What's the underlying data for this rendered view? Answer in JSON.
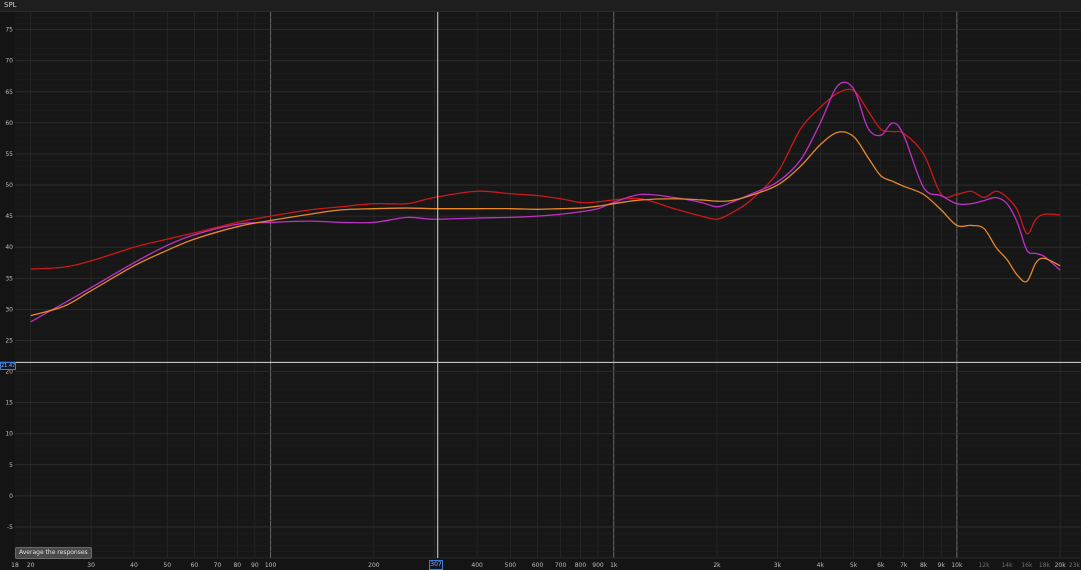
{
  "window": {
    "title": "SPL"
  },
  "cursor": {
    "x_label": "307",
    "y_label": "21.47"
  },
  "buttons": {
    "average": "Average the responses"
  },
  "chart_data": {
    "type": "line",
    "title": "",
    "xlabel": "",
    "ylabel": "SPL",
    "x_scale": "log",
    "xlim": [
      18,
      23000
    ],
    "ylim": [
      -10,
      78
    ],
    "grid": true,
    "x_ticks": [
      {
        "v": 18,
        "label": "18"
      },
      {
        "v": 20,
        "label": "20"
      },
      {
        "v": 30,
        "label": "30"
      },
      {
        "v": 40,
        "label": "40"
      },
      {
        "v": 50,
        "label": "50"
      },
      {
        "v": 60,
        "label": "60"
      },
      {
        "v": 70,
        "label": "70"
      },
      {
        "v": 80,
        "label": "80"
      },
      {
        "v": 90,
        "label": "90"
      },
      {
        "v": 100,
        "label": "100"
      },
      {
        "v": 200,
        "label": "200"
      },
      {
        "v": 400,
        "label": "400"
      },
      {
        "v": 500,
        "label": "500"
      },
      {
        "v": 600,
        "label": "600"
      },
      {
        "v": 700,
        "label": "700"
      },
      {
        "v": 800,
        "label": "800"
      },
      {
        "v": 900,
        "label": "900"
      },
      {
        "v": 1000,
        "label": "1k"
      },
      {
        "v": 2000,
        "label": "2k"
      },
      {
        "v": 3000,
        "label": "3k"
      },
      {
        "v": 4000,
        "label": "4k"
      },
      {
        "v": 5000,
        "label": "5k"
      },
      {
        "v": 6000,
        "label": "6k"
      },
      {
        "v": 7000,
        "label": "7k"
      },
      {
        "v": 8000,
        "label": "8k"
      },
      {
        "v": 9000,
        "label": "9k"
      },
      {
        "v": 10000,
        "label": "10k"
      },
      {
        "v": 12000,
        "label": "12k",
        "dim": true
      },
      {
        "v": 14000,
        "label": "14k",
        "dim": true
      },
      {
        "v": 16000,
        "label": "16k",
        "dim": true
      },
      {
        "v": 18000,
        "label": "18k",
        "dim": true
      },
      {
        "v": 20000,
        "label": "20k"
      },
      {
        "v": 23000,
        "label": "23k",
        "dim": true
      }
    ],
    "y_ticks": [
      75,
      70,
      65,
      60,
      55,
      50,
      45,
      40,
      35,
      30,
      25,
      20,
      15,
      10,
      5,
      0,
      -5
    ],
    "series": [
      {
        "color": "#cc1818",
        "x": [
          20,
          25,
          30,
          40,
          50,
          60,
          80,
          100,
          130,
          160,
          200,
          250,
          300,
          400,
          500,
          600,
          700,
          800,
          900,
          1000,
          1200,
          1500,
          1800,
          2000,
          2200,
          2500,
          3000,
          3500,
          4000,
          4500,
          5000,
          5500,
          6000,
          6500,
          7000,
          8000,
          9000,
          10000,
          11000,
          12000,
          13000,
          14000,
          15000,
          16000,
          17000,
          18000,
          20000
        ],
        "y": [
          36.5,
          36.8,
          37.8,
          40,
          41.3,
          42.3,
          44,
          45,
          46,
          46.5,
          47,
          47,
          48,
          49,
          48.6,
          48.3,
          47.8,
          47.2,
          47.3,
          47.6,
          47.8,
          46.2,
          45,
          44.5,
          45.5,
          47.5,
          52,
          59,
          62.5,
          64.8,
          65.2,
          62,
          59,
          58.6,
          58.3,
          55,
          48.5,
          48.5,
          49,
          48,
          49,
          48,
          46,
          42.2,
          44.5,
          45.3,
          45.2
        ]
      },
      {
        "color": "#c030c8",
        "x": [
          20,
          25,
          30,
          40,
          50,
          60,
          80,
          100,
          130,
          160,
          200,
          250,
          300,
          400,
          500,
          600,
          700,
          800,
          900,
          1000,
          1200,
          1500,
          1800,
          2000,
          2200,
          2500,
          3000,
          3500,
          4000,
          4500,
          5000,
          5500,
          6000,
          6500,
          7000,
          8000,
          9000,
          10000,
          11000,
          12000,
          13000,
          14000,
          15000,
          16000,
          17000,
          18000,
          20000
        ],
        "y": [
          28,
          31,
          33.5,
          37.5,
          40.3,
          42,
          43.7,
          44,
          44.2,
          44,
          44,
          44.8,
          44.5,
          44.7,
          44.8,
          45,
          45.3,
          45.7,
          46.2,
          47.2,
          48.5,
          48,
          47.2,
          46.5,
          47.2,
          48.5,
          50.5,
          54,
          60,
          66,
          65.5,
          59.2,
          58,
          60,
          58,
          49.6,
          48.3,
          47,
          47,
          47.5,
          48,
          47,
          44,
          39.5,
          39,
          38.5,
          36.3
        ]
      },
      {
        "color": "#e8892a",
        "x": [
          20,
          25,
          30,
          40,
          50,
          60,
          80,
          100,
          130,
          160,
          200,
          250,
          300,
          400,
          500,
          600,
          700,
          800,
          900,
          1000,
          1200,
          1500,
          1800,
          2000,
          2200,
          2500,
          3000,
          3500,
          4000,
          4500,
          5000,
          5500,
          6000,
          6500,
          7000,
          8000,
          9000,
          10000,
          11000,
          12000,
          13000,
          14000,
          15000,
          16000,
          17000,
          18000,
          20000
        ],
        "y": [
          29,
          30.5,
          33,
          37,
          39.5,
          41.3,
          43.3,
          44.3,
          45.3,
          46,
          46.2,
          46.3,
          46.2,
          46.2,
          46.2,
          46.1,
          46.2,
          46.3,
          46.6,
          47,
          47.6,
          47.8,
          47.6,
          47.4,
          47.5,
          48.3,
          50,
          53,
          56.5,
          58.5,
          57.8,
          54.5,
          51.5,
          50.6,
          49.8,
          48.5,
          46,
          43.5,
          43.5,
          43,
          40,
          38,
          35.5,
          34.5,
          37.5,
          38.2,
          37
        ]
      }
    ],
    "cursor": {
      "x": 307,
      "y": 21.47
    }
  }
}
